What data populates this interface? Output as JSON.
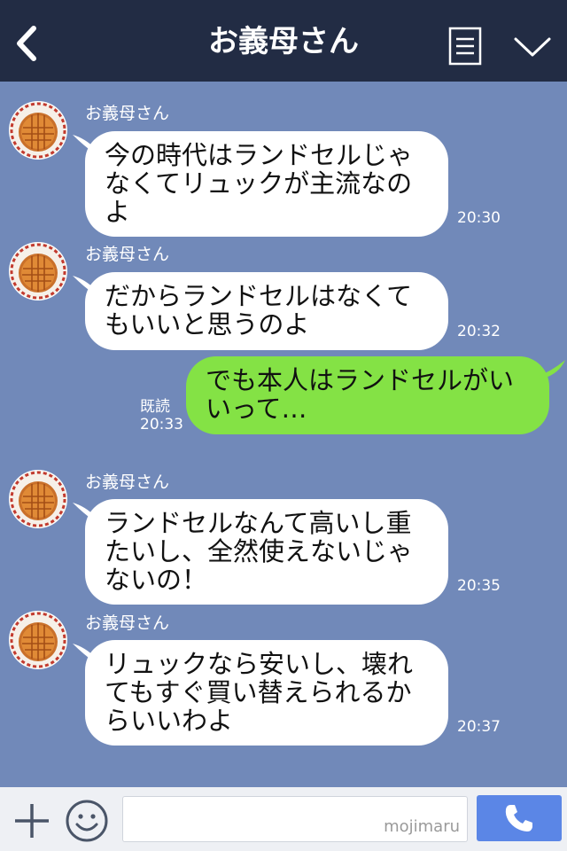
{
  "header": {
    "title": "お義母さん",
    "icons": [
      "back-arrow-icon",
      "menu-icon",
      "chevron-down-icon"
    ]
  },
  "colors": {
    "header_bg": "#222c44",
    "chat_bg": "#7189b9",
    "incoming_bubble": "#ffffff",
    "outgoing_bubble": "#84e245",
    "call_button": "#5b86e6"
  },
  "messages": [
    {
      "sender": "お義母さん",
      "text": "今の時代はランドセルじゃ\nなくてリュックが主流なの\nよ",
      "time": "20:30"
    },
    {
      "sender": "お義母さん",
      "text": "だからランドセルはなくて\nもいいと思うのよ",
      "time": "20:32"
    },
    {
      "text": "でも本人はランドセルがい\nいって…",
      "read_label": "既読",
      "time": "20:33"
    },
    {
      "sender": "お義母さん",
      "text": "ランドセルなんて高いし重\nたいし、全然使えないじゃ\nないの！",
      "time": "20:35"
    },
    {
      "sender": "お義母さん",
      "text": "リュックなら安いし、壊れ\nてもすぐ買い替えられるか\nらいいわよ",
      "time": "20:37"
    }
  ],
  "input_bar": {
    "watermark": "mojimaru",
    "icons": [
      "plus-icon",
      "emoji-icon",
      "phone-icon"
    ]
  }
}
